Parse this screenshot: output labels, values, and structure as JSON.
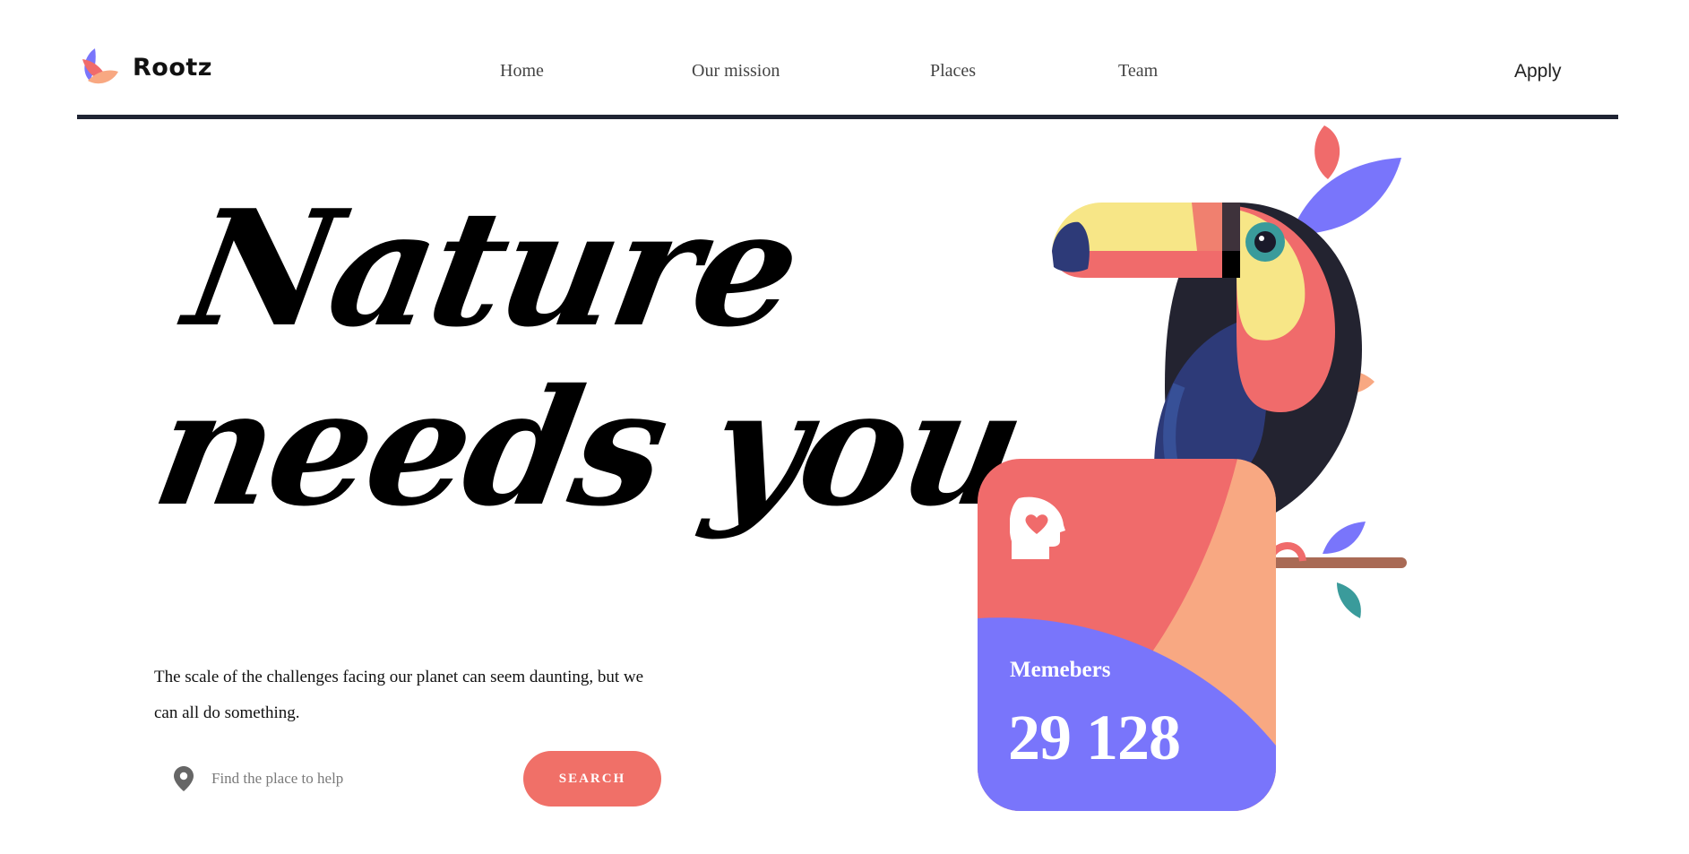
{
  "brand": {
    "name": "Rootz",
    "logo_icon": "petal-logo-icon"
  },
  "nav": {
    "items": [
      {
        "label": "Home"
      },
      {
        "label": "Our mission"
      },
      {
        "label": "Places"
      },
      {
        "label": "Team"
      }
    ],
    "apply_label": "Apply"
  },
  "hero": {
    "title_line1": "Nature",
    "title_line2": "needs you",
    "description": "The scale of the challenges facing our planet can seem daunting, but we can all do something."
  },
  "search": {
    "placeholder": "Find the place to help",
    "value": "",
    "button_label": "SEARCH",
    "icon": "location-pin-icon"
  },
  "members_card": {
    "label": "Memebers",
    "count": "29 128",
    "icon": "heart-head-icon"
  },
  "colors": {
    "coral": "#f06b6b",
    "peach": "#f8a882",
    "periwinkle": "#7975fb",
    "navy": "#1f2433",
    "yellow": "#f7e687",
    "teal": "#3a9b9b"
  }
}
